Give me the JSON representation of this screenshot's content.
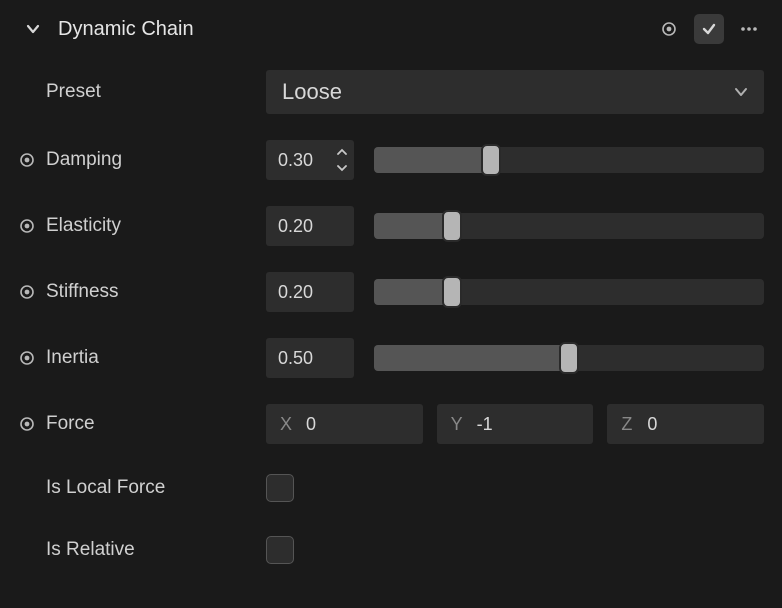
{
  "header": {
    "title": "Dynamic Chain",
    "record_icon": "radio-dot",
    "enabled": true,
    "more_icon": "more-horizontal"
  },
  "preset": {
    "label": "Preset",
    "value": "Loose"
  },
  "props": {
    "damping": {
      "label": "Damping",
      "value": "0.30",
      "pct": 30
    },
    "elasticity": {
      "label": "Elasticity",
      "value": "0.20",
      "pct": 20
    },
    "stiffness": {
      "label": "Stiffness",
      "value": "0.20",
      "pct": 20
    },
    "inertia": {
      "label": "Inertia",
      "value": "0.50",
      "pct": 50
    }
  },
  "force": {
    "label": "Force",
    "x_axis": "X",
    "x": "0",
    "y_axis": "Y",
    "y": "-1",
    "z_axis": "Z",
    "z": "0"
  },
  "isLocalForce": {
    "label": "Is Local Force",
    "checked": false
  },
  "isRelative": {
    "label": "Is Relative",
    "checked": false
  }
}
